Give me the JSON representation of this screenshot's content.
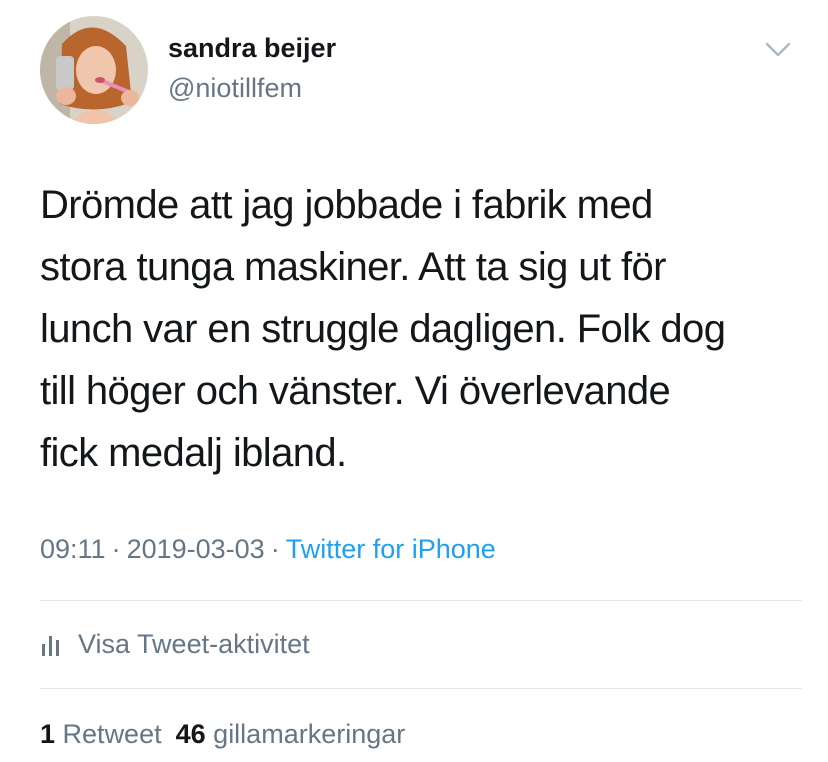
{
  "author": {
    "display_name": "sandra beijer",
    "handle": "@niotillfem",
    "avatar_icon": "profile-photo"
  },
  "menu_icon": "chevron-down-icon",
  "tweet": {
    "lines": [
      "Drömde att jag jobbade i fabrik med",
      "stora tunga maskiner. Att ta sig ut för",
      "lunch var en struggle dagligen. Folk dog",
      "till höger och vänster. Vi överlevande",
      "fick medalj ibland."
    ]
  },
  "meta": {
    "time": "09:11",
    "separator": "·",
    "date": "2019-03-03",
    "source": "Twitter for iPhone"
  },
  "activity": {
    "icon": "bar-chart-icon",
    "label": "Visa Tweet-aktivitet"
  },
  "stats": {
    "retweets_count": "1",
    "retweets_label": "Retweet",
    "likes_count": "46",
    "likes_label": "gillamarkeringar"
  },
  "colors": {
    "text": "#14171a",
    "secondary": "#657786",
    "link": "#1da1f2",
    "divider": "#e1e8ed"
  }
}
